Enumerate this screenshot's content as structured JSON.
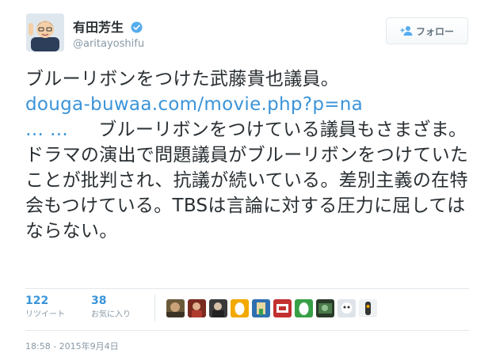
{
  "user": {
    "display_name": "有田芳生",
    "screen_name": "@aritayoshifu",
    "verified": true
  },
  "follow_button": {
    "label": "フォロー",
    "icon": "add-user-icon"
  },
  "tweet": {
    "text_part1": "ブルーリボンをつけた武藤貴也議員。",
    "link": "douga-buwaa.com/movie.php?p=na",
    "ellipsis": "… …",
    "text_part2": "ブルーリボンをつけている議員もさまざま。ドラマの演出で問題議員がブルーリボンをつけていたことが批判され、抗議が続いている。差別主義の在特会もつけている。TBSは言論に対する圧力に屈してはならない。"
  },
  "stats": {
    "retweets": {
      "count": "122",
      "label": "リツイート"
    },
    "favorites": {
      "count": "38",
      "label": "お気に入り"
    }
  },
  "favorited_by_count": 9,
  "timestamp": "18:58 - 2015年9月4日",
  "colors": {
    "link": "#3b94d9",
    "muted": "#8899a6",
    "text": "#292f33",
    "border": "#e1e8ed"
  }
}
